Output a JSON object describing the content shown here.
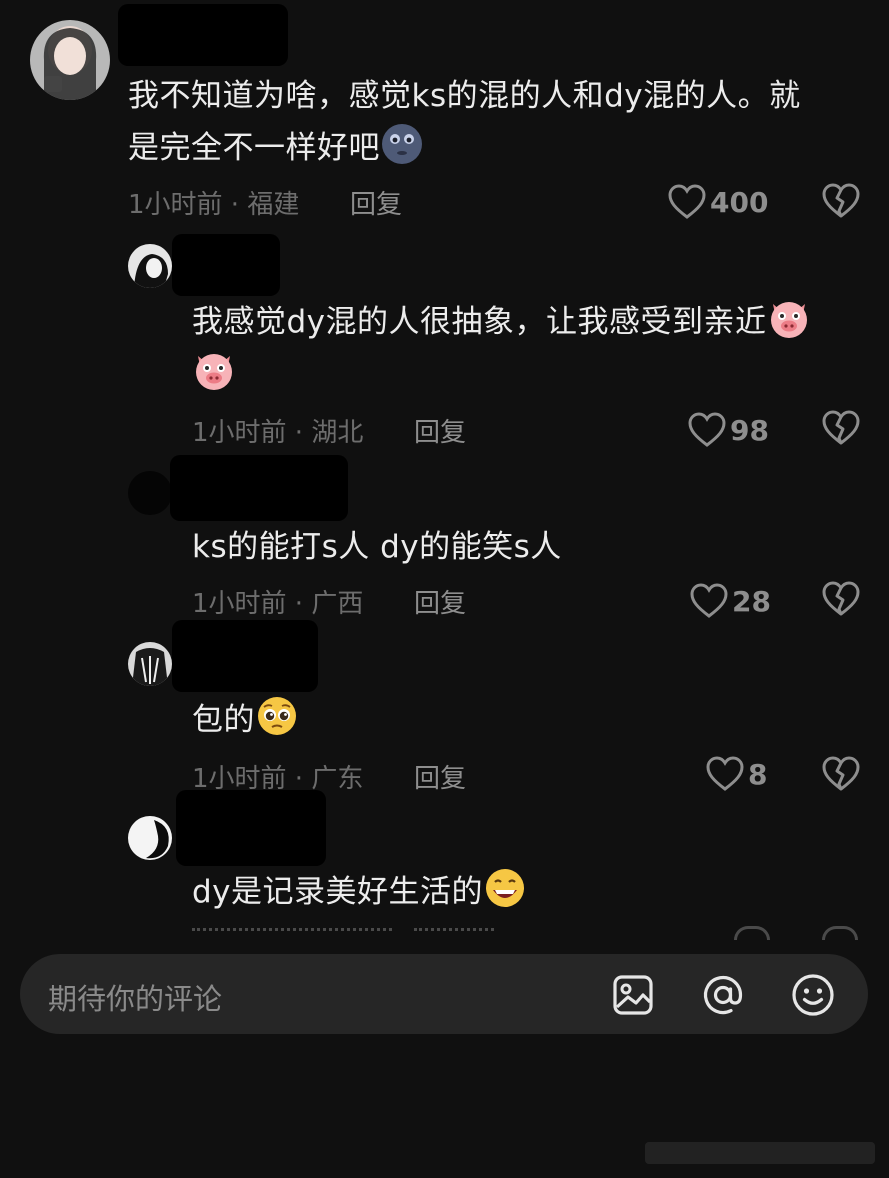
{
  "comments": [
    {
      "text_parts": [
        "我不知道为啥，感觉ks的混的人和dy混的人。就",
        "是完全不一样好吧"
      ],
      "emoji": "moon-face-emoji",
      "time_location": "1小时前 · 福建",
      "reply_label": "回复",
      "likes": "400"
    },
    {
      "text_parts": [
        "我感觉dy混的人很抽象，让我感受到亲近"
      ],
      "emoji": "pig-face-emoji",
      "time_location": "1小时前 · 湖北",
      "reply_label": "回复",
      "likes": "98"
    },
    {
      "text_parts": [
        "ks的能打s人 dy的能笑s人"
      ],
      "time_location": "1小时前 · 广西",
      "reply_label": "回复",
      "likes": "28"
    },
    {
      "text_parts": [
        "包的"
      ],
      "emoji": "pleading-face-emoji",
      "time_location": "1小时前 · 广东",
      "reply_label": "回复",
      "likes": "8"
    },
    {
      "text_parts": [
        "dy是记录美好生活的"
      ],
      "emoji": "grinning-face-emoji"
    }
  ],
  "input": {
    "placeholder": "期待你的评论",
    "icons": [
      "image-icon",
      "at-icon",
      "emoji-icon"
    ]
  },
  "colors": {
    "background": "#101010",
    "text": "#ececec",
    "meta": "#6d6d6d",
    "input_bg": "#262626"
  }
}
